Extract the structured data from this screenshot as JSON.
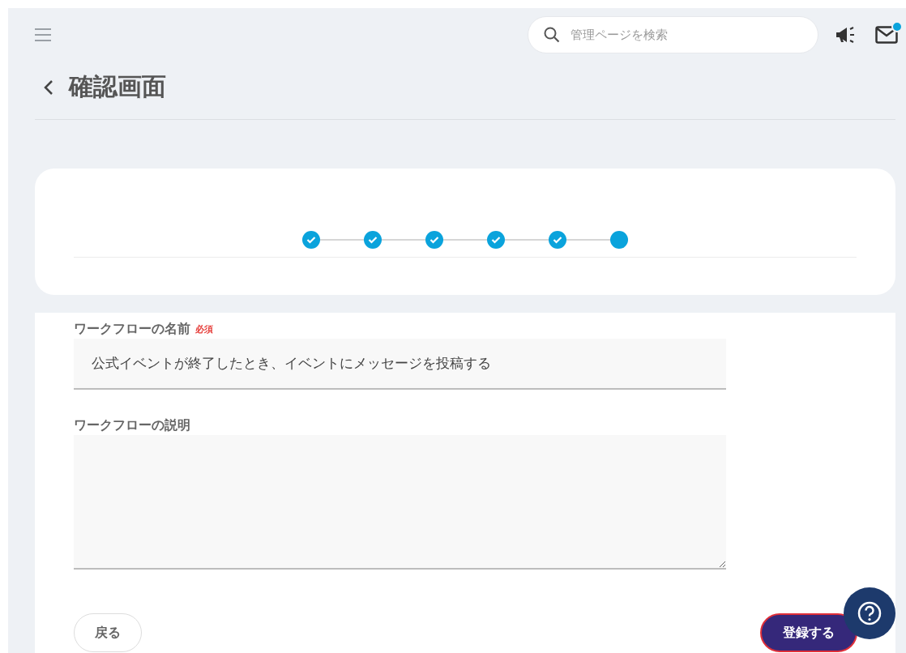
{
  "header": {
    "search": {
      "placeholder": "管理ページを検索"
    },
    "mail_unread": true
  },
  "page_title": "確認画面",
  "steps": [
    {
      "done": true
    },
    {
      "done": true
    },
    {
      "done": true
    },
    {
      "done": true
    },
    {
      "done": true
    },
    {
      "done": false
    }
  ],
  "form": {
    "fields": [
      {
        "kind": "input",
        "label": "ワークフローの名前",
        "required_badge": "必須",
        "value": "公式イベントが終了したとき、イベントにメッセージを投稿する"
      },
      {
        "kind": "textarea",
        "label": "ワークフローの説明"
      }
    ]
  },
  "buttons": {
    "back": "戻る",
    "submit": "登録する"
  }
}
